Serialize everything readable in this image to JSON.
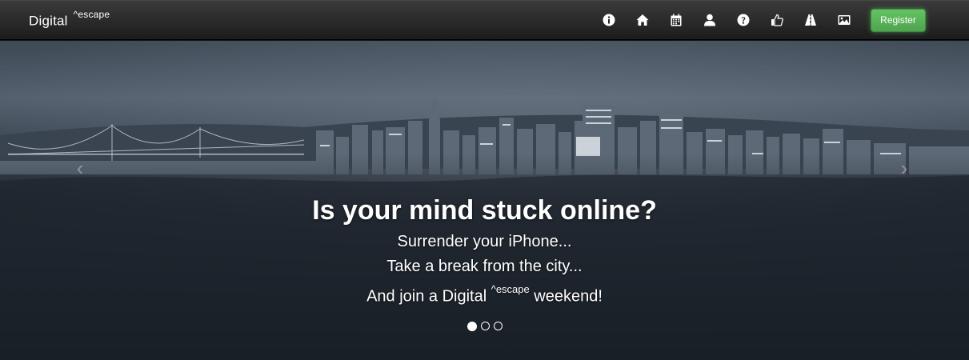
{
  "navbar": {
    "brand": "Digital",
    "brand_sup": "^escape",
    "icons": [
      "info-icon",
      "home-icon",
      "calendar-icon",
      "user-icon",
      "question-icon",
      "thumbs-up-icon",
      "road-icon",
      "picture-icon"
    ],
    "register_label": "Register",
    "register_color": "#51a351"
  },
  "hero": {
    "headline": "Is your mind stuck online?",
    "line1": "Surrender your iPhone...",
    "line2": "Take a break from the city...",
    "line3_prefix": "And join a Digital ",
    "line3_sup": "^escape",
    "line3_suffix": " weekend!",
    "prev_arrow": "‹",
    "next_arrow": "›",
    "slides": 3,
    "active_slide": 1
  }
}
